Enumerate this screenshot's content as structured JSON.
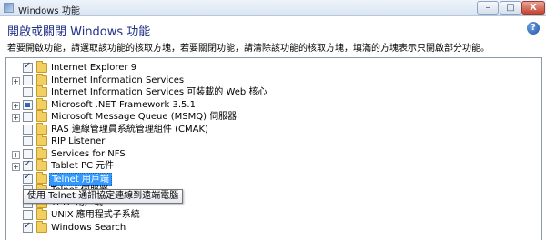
{
  "window": {
    "title": "Windows 功能",
    "minimize_glyph": "–",
    "maximize_glyph": "□",
    "close_glyph": "X"
  },
  "header": {
    "heading": "開啟或關閉 Windows 功能",
    "help_glyph": "?",
    "description": "若要開啟功能，請選取該功能的核取方塊，若要關閉功能，請清除該功能的核取方塊，填滿的方塊表示只開啟部分功能。"
  },
  "features": [
    {
      "label": "Internet Explorer 9",
      "checked": true,
      "expandable": false
    },
    {
      "label": "Internet Information Services",
      "checked": false,
      "expandable": true
    },
    {
      "label": "Internet Information Services 可裝載的 Web 核心",
      "checked": false,
      "expandable": false
    },
    {
      "label": "Microsoft .NET Framework 3.5.1",
      "checked": "partial",
      "expandable": true
    },
    {
      "label": "Microsoft Message Queue (MSMQ) 伺服器",
      "checked": false,
      "expandable": true
    },
    {
      "label": "RAS 連線管理員系統管理組件 (CMAK)",
      "checked": false,
      "expandable": false
    },
    {
      "label": "RIP Listener",
      "checked": false,
      "expandable": false
    },
    {
      "label": "Services for NFS",
      "checked": false,
      "expandable": true
    },
    {
      "label": "Tablet PC 元件",
      "checked": true,
      "expandable": true
    },
    {
      "label": "Telnet 用戶端",
      "checked": true,
      "expandable": false,
      "selected": true
    },
    {
      "label": "Telnet 伺服器",
      "checked": false,
      "expandable": false
    },
    {
      "label": "TFTP 用戶端",
      "checked": false,
      "expandable": false
    },
    {
      "label": "UNIX 應用程式子系統",
      "checked": false,
      "expandable": false
    },
    {
      "label": "Windows Search",
      "checked": true,
      "expandable": false
    }
  ],
  "tooltip": "使用 Telnet 通訊協定連線到遠端電腦",
  "colors": {
    "heading": "#1e3287",
    "selection": "#3399ff"
  }
}
